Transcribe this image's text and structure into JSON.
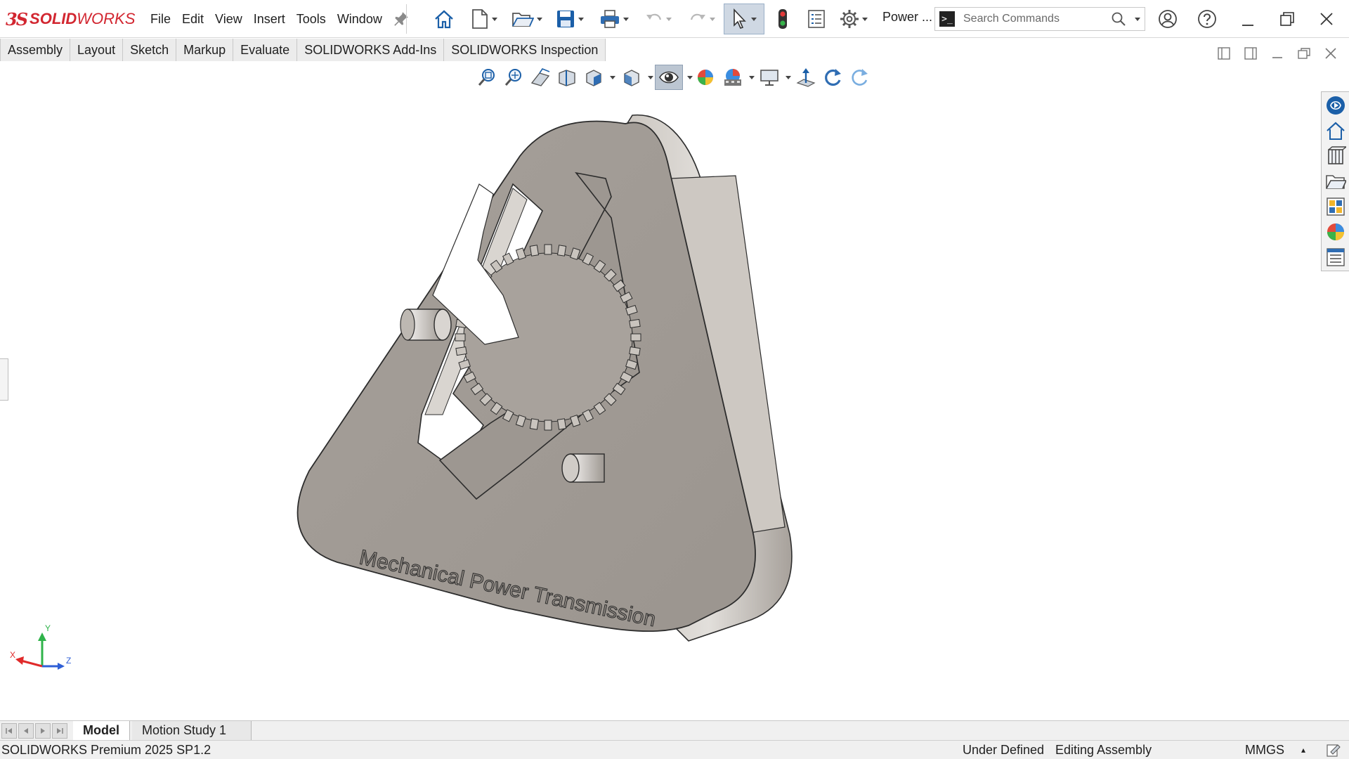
{
  "app": {
    "logo": {
      "ds": "3S",
      "solid": "SOLID",
      "works": "WORKS"
    },
    "brand_color": "#d22630"
  },
  "menu": [
    "File",
    "Edit",
    "View",
    "Insert",
    "Tools",
    "Window"
  ],
  "toolbar": {
    "icons": [
      "home-icon",
      "new-document-icon",
      "open-icon",
      "save-icon",
      "print-icon",
      "undo-icon",
      "redo-icon",
      "select-icon",
      "rebuild-icon",
      "file-properties-icon",
      "options-icon"
    ],
    "power_label": "Power ...",
    "search_placeholder": "Search Commands"
  },
  "commandmanager_tabs": [
    "Assembly",
    "Layout",
    "Sketch",
    "Markup",
    "Evaluate",
    "SOLIDWORKS Add-Ins",
    "SOLIDWORKS Inspection"
  ],
  "heads_up_toolbar": [
    "zoom-to-fit-icon",
    "zoom-to-area-icon",
    "previous-view-icon",
    "section-view-icon",
    "view-orientation-icon",
    "display-style-icon",
    "hide-show-items-icon",
    "edit-appearance-icon",
    "apply-scene-icon",
    "view-settings-icon",
    "normal-to-icon",
    "rotate-icon",
    "redo-view-icon"
  ],
  "task_pane": [
    "solidworks-resources-icon",
    "home-icon",
    "design-library-icon",
    "file-explorer-icon",
    "view-palette-icon",
    "appearances-icon",
    "custom-properties-icon"
  ],
  "model": {
    "engraved_text": "Mechanical Power Transmission",
    "body_color": "#a8a29d"
  },
  "triad": {
    "x": "X",
    "y": "Y",
    "z": "Z"
  },
  "bottom_tabs": {
    "model": "Model",
    "motion": "Motion Study 1"
  },
  "status": {
    "version": "SOLIDWORKS Premium 2025 SP1.2",
    "definition": "Under Defined",
    "mode": "Editing Assembly",
    "units": "MMGS"
  }
}
